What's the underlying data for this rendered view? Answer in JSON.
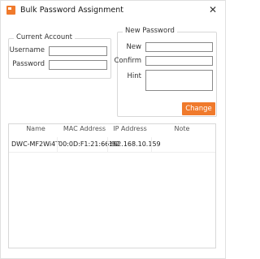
{
  "window": {
    "title": "Bulk Password Assignment",
    "close_glyph": "✕",
    "accent_color": "#f07a2c"
  },
  "current_account": {
    "legend": "Current Account",
    "username_label": "Username",
    "username_value": "",
    "password_label": "Password",
    "password_value": ""
  },
  "new_password": {
    "legend": "New Password",
    "new_label": "New",
    "new_value": "",
    "confirm_label": "Confirm",
    "confirm_value": "",
    "hint_label": "Hint",
    "hint_value": ""
  },
  "change_button": "Change",
  "table": {
    "headers": [
      "Name",
      "MAC Address",
      "IP Address",
      "Note"
    ],
    "rows": [
      [
        "DWC-MF2Wi4T",
        "00:0D:F1:21:66:92",
        "192.168.10.159",
        ""
      ]
    ]
  }
}
